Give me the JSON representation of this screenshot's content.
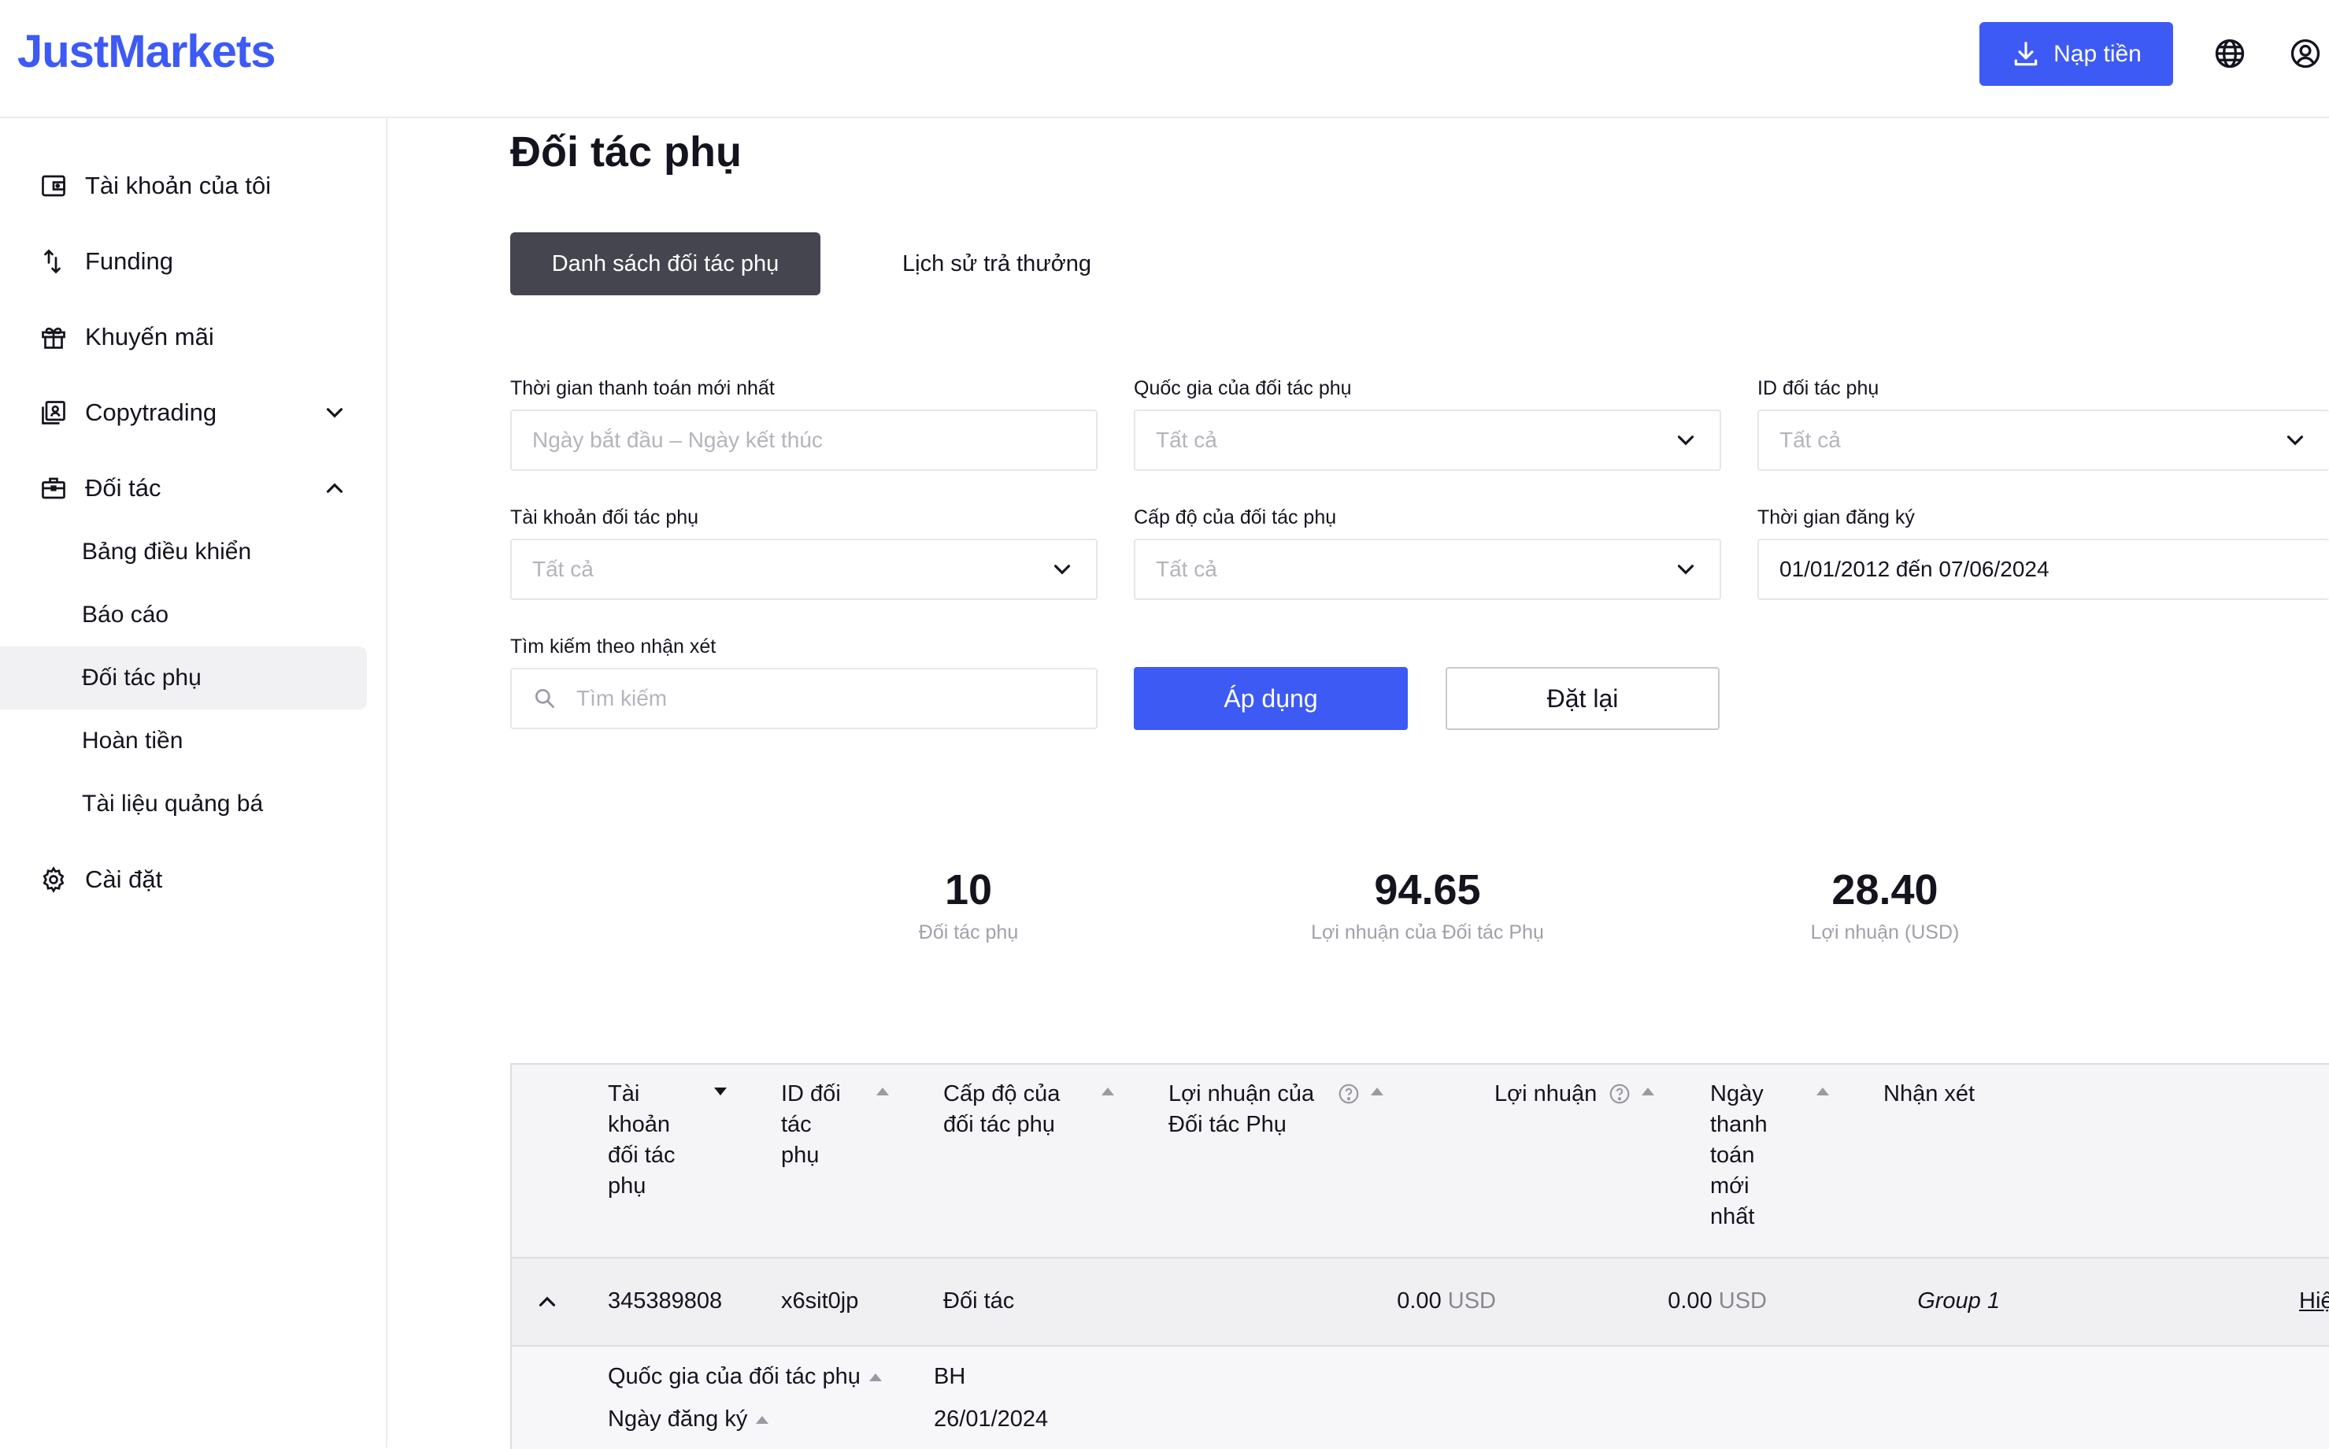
{
  "header": {
    "logo": "JustMarkets",
    "deposit_label": "Nạp tiền"
  },
  "sidebar": {
    "items": [
      {
        "label": "Tài khoản của tôi"
      },
      {
        "label": "Funding"
      },
      {
        "label": "Khuyến mãi"
      },
      {
        "label": "Copytrading"
      },
      {
        "label": "Đối tác"
      },
      {
        "label": "Cài đặt"
      }
    ],
    "partner_sub": [
      {
        "label": "Bảng điều khiển"
      },
      {
        "label": "Báo cáo"
      },
      {
        "label": "Đối tác phụ"
      },
      {
        "label": "Hoàn tiền"
      },
      {
        "label": "Tài liệu quảng bá"
      }
    ]
  },
  "page": {
    "title": "Đối tác phụ",
    "tabs": [
      {
        "label": "Danh sách đối tác phụ"
      },
      {
        "label": "Lịch sử trả thưởng"
      }
    ]
  },
  "filters": {
    "last_payment": {
      "label": "Thời gian thanh toán mới nhất",
      "placeholder": "Ngày bắt đầu – Ngày kết thúc"
    },
    "country": {
      "label": "Quốc gia của đối tác phụ",
      "value": "Tất cả"
    },
    "id": {
      "label": "ID đối tác phụ",
      "value": "Tất cả"
    },
    "account": {
      "label": "Tài khoản đối tác phụ",
      "value": "Tất cả"
    },
    "level": {
      "label": "Cấp độ của đối tác phụ",
      "value": "Tất cả"
    },
    "registered": {
      "label": "Thời gian đăng ký",
      "value": "01/01/2012 đến 07/06/2024"
    },
    "search": {
      "label": "Tìm kiếm theo nhận xét",
      "placeholder": "Tìm kiếm"
    },
    "apply_label": "Áp dụng",
    "reset_label": "Đặt lại"
  },
  "stats": [
    {
      "value": "10",
      "label": "Đối tác phụ"
    },
    {
      "value": "94.65",
      "label": "Lợi nhuận của Đối tác Phụ"
    },
    {
      "value": "28.40",
      "label": "Lợi nhuận (USD)"
    }
  ],
  "table": {
    "headers": {
      "account": [
        "Tài",
        "khoản",
        "đối tác",
        "phụ"
      ],
      "id": [
        "ID đối",
        "tác",
        "phụ"
      ],
      "level": [
        "Cấp độ của",
        "đối tác phụ"
      ],
      "sub_profit": [
        "Lợi nhuận của",
        "Đối tác Phụ"
      ],
      "profit": "Lợi nhuận",
      "last_payment": [
        "Ngày",
        "thanh",
        "toán",
        "mới",
        "nhất"
      ],
      "comment": "Nhận xét"
    },
    "row": {
      "account": "345389808",
      "id": "x6sit0jp",
      "level": "Đối tác",
      "sub_profit": "0.00",
      "sub_profit_unit": "USD",
      "profit": "0.00",
      "profit_unit": "USD",
      "comment": "Group 1",
      "edit_link": "Hiệ"
    },
    "expanded": {
      "country_label": "Quốc gia của đối tác phụ",
      "country_value": "BH",
      "registered_label": "Ngày đăng ký",
      "registered_value": "26/01/2024"
    }
  }
}
